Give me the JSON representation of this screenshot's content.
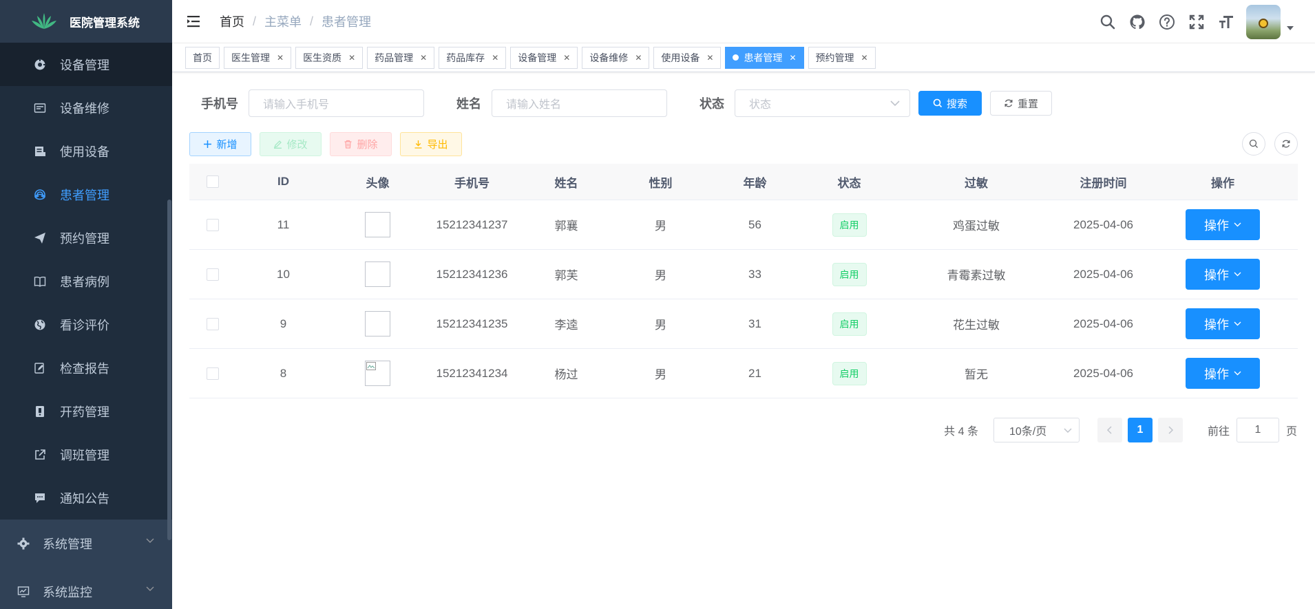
{
  "app": {
    "title": "医院管理系统"
  },
  "sidebar": {
    "sub_items": [
      {
        "label": "设备管理",
        "icon": "device-icon",
        "active": false
      },
      {
        "label": "设备维修",
        "icon": "repair-icon",
        "active": false
      },
      {
        "label": "使用设备",
        "icon": "device-usage-icon",
        "active": false
      },
      {
        "label": "患者管理",
        "icon": "patient-icon",
        "active": true
      },
      {
        "label": "预约管理",
        "icon": "send-icon",
        "active": false
      },
      {
        "label": "患者病例",
        "icon": "book-icon",
        "active": false
      },
      {
        "label": "看诊评价",
        "icon": "globe-icon",
        "active": false
      },
      {
        "label": "检查报告",
        "icon": "report-edit-icon",
        "active": false
      },
      {
        "label": "开药管理",
        "icon": "prescription-icon",
        "active": false
      },
      {
        "label": "调班管理",
        "icon": "external-link-icon",
        "active": false
      },
      {
        "label": "通知公告",
        "icon": "message-icon",
        "active": false
      }
    ],
    "menus": [
      {
        "label": "系统管理",
        "icon": "gear-icon"
      },
      {
        "label": "系统监控",
        "icon": "monitor-icon"
      }
    ]
  },
  "header": {
    "breadcrumb": [
      "首页",
      "主菜单",
      "患者管理"
    ],
    "icons": [
      "search-icon",
      "github-icon",
      "help-icon",
      "fullscreen-icon",
      "font-size-icon"
    ]
  },
  "tags": [
    {
      "label": "首页",
      "closable": false,
      "active": false
    },
    {
      "label": "医生管理",
      "closable": true,
      "active": false
    },
    {
      "label": "医生资质",
      "closable": true,
      "active": false
    },
    {
      "label": "药品管理",
      "closable": true,
      "active": false
    },
    {
      "label": "药品库存",
      "closable": true,
      "active": false
    },
    {
      "label": "设备管理",
      "closable": true,
      "active": false
    },
    {
      "label": "设备维修",
      "closable": true,
      "active": false
    },
    {
      "label": "使用设备",
      "closable": true,
      "active": false
    },
    {
      "label": "患者管理",
      "closable": true,
      "active": true
    },
    {
      "label": "预约管理",
      "closable": true,
      "active": false
    }
  ],
  "search": {
    "phone_label": "手机号",
    "phone_placeholder": "请输入手机号",
    "name_label": "姓名",
    "name_placeholder": "请输入姓名",
    "status_label": "状态",
    "status_placeholder": "状态",
    "search_btn": "搜索",
    "reset_btn": "重置"
  },
  "toolbar": {
    "add": "新增",
    "edit": "修改",
    "delete": "删除",
    "export": "导出"
  },
  "table": {
    "headers": [
      "ID",
      "头像",
      "手机号",
      "姓名",
      "性别",
      "年龄",
      "状态",
      "过敏",
      "注册时间",
      "操作"
    ],
    "rows": [
      {
        "id": "11",
        "phone": "15212341237",
        "name": "郭襄",
        "gender": "男",
        "age": "56",
        "status": "启用",
        "allergy": "鸡蛋过敏",
        "date": "2025-04-06",
        "op": "操作",
        "broken_img": false
      },
      {
        "id": "10",
        "phone": "15212341236",
        "name": "郭芙",
        "gender": "男",
        "age": "33",
        "status": "启用",
        "allergy": "青霉素过敏",
        "date": "2025-04-06",
        "op": "操作",
        "broken_img": false
      },
      {
        "id": "9",
        "phone": "15212341235",
        "name": "李逵",
        "gender": "男",
        "age": "31",
        "status": "启用",
        "allergy": "花生过敏",
        "date": "2025-04-06",
        "op": "操作",
        "broken_img": false
      },
      {
        "id": "8",
        "phone": "15212341234",
        "name": "杨过",
        "gender": "男",
        "age": "21",
        "status": "启用",
        "allergy": "暂无",
        "date": "2025-04-06",
        "op": "操作",
        "broken_img": true
      }
    ]
  },
  "pagination": {
    "total": "共 4 条",
    "page_size": "10条/页",
    "current": "1",
    "goto_prefix": "前往",
    "goto_value": "1",
    "goto_suffix": "页"
  },
  "colors": {
    "primary": "#1890ff",
    "sidebar": "#304156",
    "active_menu": "#409eff",
    "success": "#13ce66"
  }
}
